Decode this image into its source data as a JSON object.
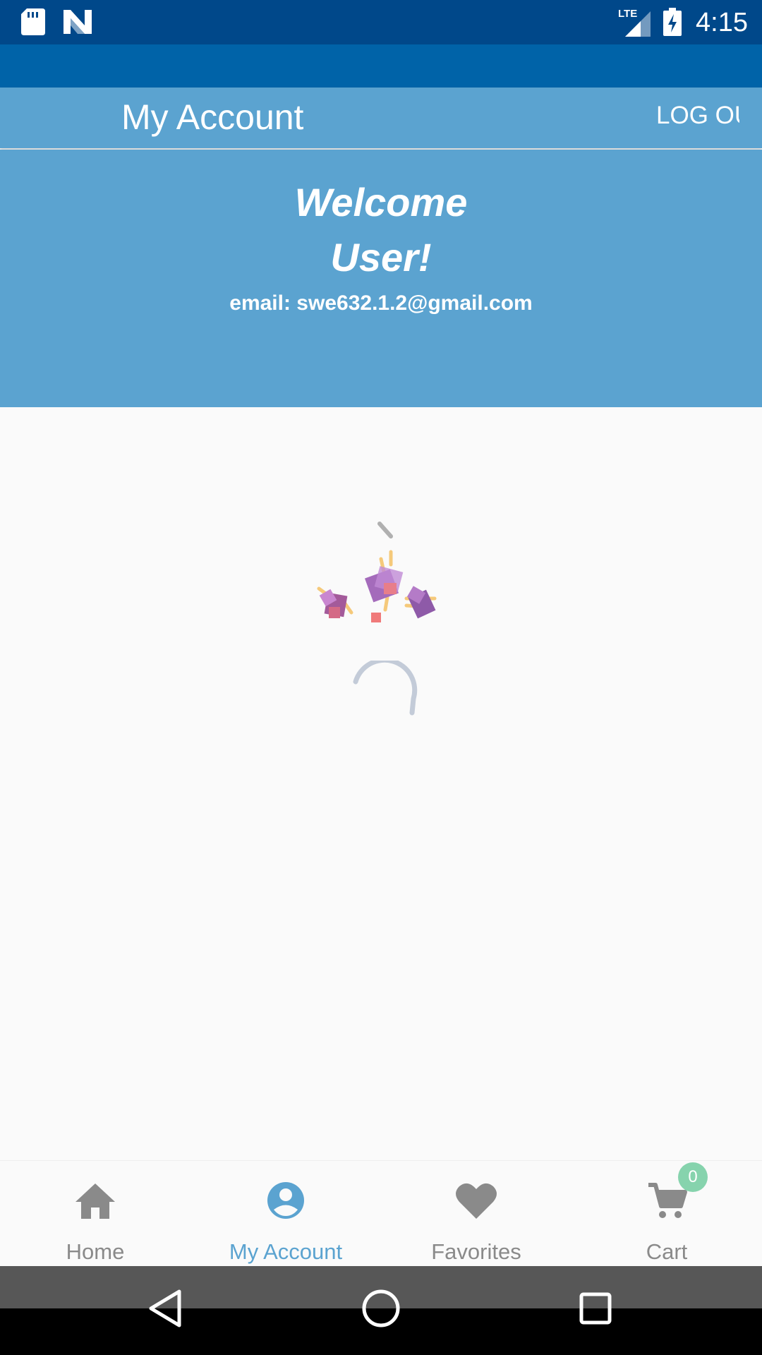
{
  "status_bar": {
    "time": "4:15",
    "network_label": "LTE",
    "icons": [
      "sd-card-icon",
      "n-notification-icon",
      "lte-signal-icon",
      "battery-charging-icon"
    ]
  },
  "app_bar": {
    "title": "My Account",
    "logout_label": "LOG OUT"
  },
  "welcome": {
    "line1": "Welcome",
    "line2": "User!",
    "email": "email: swe632.1.2@gmail.com"
  },
  "bottom_nav": {
    "items": [
      {
        "label": "Home",
        "icon": "home-icon",
        "active": false
      },
      {
        "label": "My Account",
        "icon": "account-circle-icon",
        "active": true
      },
      {
        "label": "Favorites",
        "icon": "heart-icon",
        "active": false
      },
      {
        "label": "Cart",
        "icon": "cart-icon",
        "active": false
      }
    ],
    "cart_count": "0"
  },
  "system_nav": {
    "icons": [
      "back-icon",
      "home-circle-icon",
      "recents-icon"
    ]
  },
  "colors": {
    "status_bar": "#00488a",
    "toolbar_strip": "#0063a8",
    "header": "#5ba3d0",
    "nav_active": "#5ba3d0",
    "nav_inactive": "#8a8a8a",
    "badge": "#86d3ad"
  }
}
